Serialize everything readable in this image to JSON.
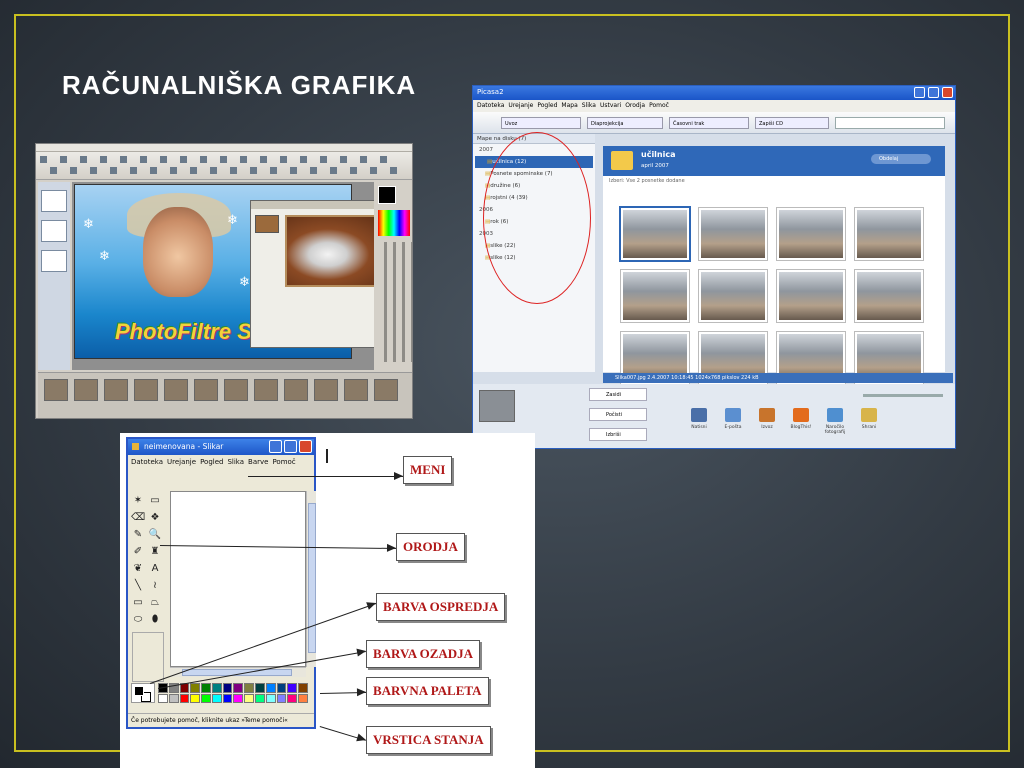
{
  "slide": {
    "title": "RAČUNALNIŠKA GRAFIKA",
    "frame_color": "#c9c020"
  },
  "photofiltre": {
    "canvas_text": "PhotoFiltre Studio"
  },
  "picasa": {
    "title": "Picasa2",
    "menu": [
      "Datoteka",
      "Urejanje",
      "Pogled",
      "Mapa",
      "Slika",
      "Ustvari",
      "Orodja",
      "Pomoč"
    ],
    "toolbar": {
      "import": "Uvoz",
      "slideshow": "Diaprojekcija",
      "timeline": "Časovni trak",
      "burn_cd": "Zapiši CD"
    },
    "sidebar": {
      "header": "Mape na disku (7)",
      "groups": [
        {
          "year": "2007",
          "items": [
            {
              "label": "učilnica (12)",
              "selected": true
            },
            {
              "label": "Posnete spominske (7)",
              "selected": false
            },
            {
              "label": "družine (6)",
              "selected": false
            },
            {
              "label": "rojstni (4 (39)",
              "selected": false
            }
          ]
        },
        {
          "year": "2006",
          "items": [
            {
              "label": "rok (6)",
              "selected": false
            }
          ]
        },
        {
          "year": "2003",
          "items": [
            {
              "label": "slike (22)",
              "selected": false
            },
            {
              "label": "slike (12)",
              "selected": false
            }
          ]
        }
      ]
    },
    "album": {
      "name": "učilnica",
      "date": "april 2007",
      "subtitle": "Izberi: Vse 2 posnetke dodane",
      "pill": "Obdelaj"
    },
    "status_bar": "Slika007.jpg     2.4.2007 10:18:45     1024x768 pikslov 224 kB",
    "bottom_buttons": [
      "Zasidi",
      "Počisti",
      "Izbriši"
    ],
    "actions": [
      "Natisni",
      "E-pošta",
      "Izvoz",
      "BlogThis!",
      "Naročilo fotografij",
      "Shrani"
    ],
    "photo_count": 12
  },
  "slikar": {
    "title": "neimenovana - Slikar",
    "menu": [
      "Datoteka",
      "Urejanje",
      "Pogled",
      "Slika",
      "Barve",
      "Pomoč"
    ],
    "status": "Če potrebujete pomoč, kliknite ukaz »Teme pomoči«",
    "tools": [
      "✶",
      "▭",
      "⌫",
      "❖",
      "✎",
      "🔍",
      "✐",
      "♜",
      "❦",
      "A",
      "╲",
      "≀",
      "▭",
      "⏢",
      "⬭",
      "⬮"
    ],
    "palette": [
      "#000000",
      "#808080",
      "#800000",
      "#808000",
      "#008000",
      "#008080",
      "#000080",
      "#800080",
      "#808040",
      "#004040",
      "#0080ff",
      "#004080",
      "#4000ff",
      "#804000",
      "#ffffff",
      "#c0c0c0",
      "#ff0000",
      "#ffff00",
      "#00ff00",
      "#00ffff",
      "#0000ff",
      "#ff00ff",
      "#ffff80",
      "#00ff80",
      "#80ffff",
      "#8080ff",
      "#ff0080",
      "#ff8040"
    ]
  },
  "callouts": {
    "menu": "MENI",
    "tools": "ORODJA",
    "foreground_color": "BARVA OSPREDJA",
    "background_color": "BARVA OZADJA",
    "palette": "BARVNA PALETA",
    "status_bar": "VRSTICA STANJA",
    "text_color": "#b01818"
  }
}
